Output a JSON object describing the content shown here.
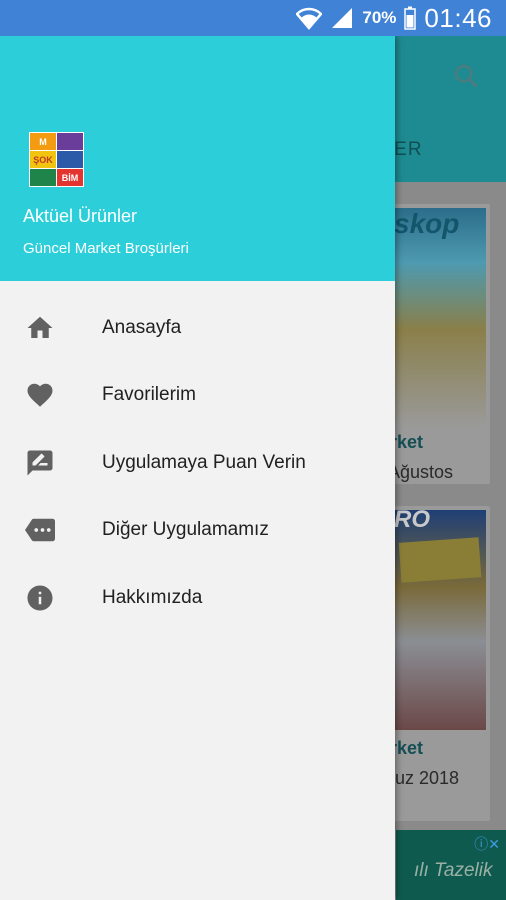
{
  "status_bar": {
    "battery": "70%",
    "time": "01:46"
  },
  "drawer": {
    "app_name": "Aktüel Ürünler",
    "app_subtitle": "Güncel Market Broşürleri",
    "logo_brands": [
      "M",
      "ŞOK",
      "BİM"
    ],
    "items": [
      {
        "label": "Anasayfa",
        "icon": "home-icon"
      },
      {
        "label": "Favorilerim",
        "icon": "heart-icon"
      },
      {
        "label": "Uygulamaya Puan Verin",
        "icon": "rate-review-icon"
      },
      {
        "label": "Diğer Uygulamamız",
        "icon": "more-apps-icon"
      },
      {
        "label": "Hakkımızda",
        "icon": "info-icon"
      }
    ]
  },
  "background": {
    "tab_label": "TLER",
    "cards": [
      {
        "brand": "skop",
        "title": "arket",
        "subtitle": "l Ağustos"
      },
      {
        "brand": "RO",
        "title": "arket",
        "subtitle": "muz 2018"
      }
    ],
    "ad_text": "ılı Tazelik"
  },
  "colors": {
    "status_bar": "#3f82d6",
    "drawer_header": "#2ccfd9",
    "drawer_bg": "#f2f2f2",
    "icon": "#616161"
  }
}
